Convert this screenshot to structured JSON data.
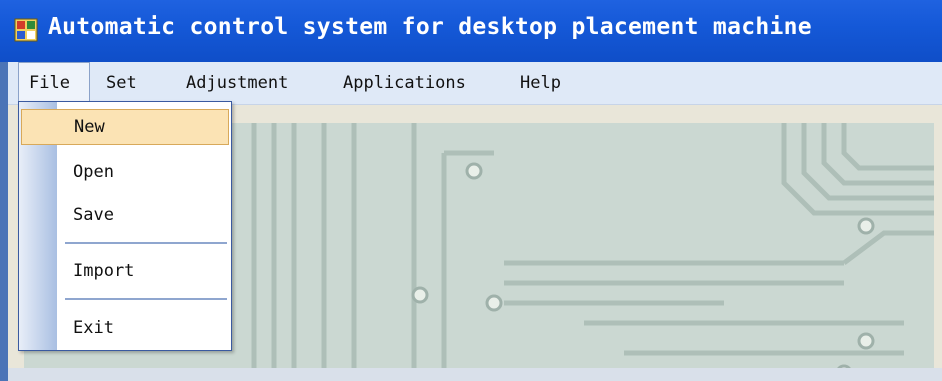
{
  "window": {
    "title": "Automatic control system for desktop placement machine",
    "icon": "app-window-icon"
  },
  "menubar": {
    "items": [
      {
        "label": "File",
        "active": true
      },
      {
        "label": "Set"
      },
      {
        "label": "Adjustment"
      },
      {
        "label": "Applications"
      },
      {
        "label": "Help"
      }
    ]
  },
  "file_menu": {
    "items": [
      {
        "label": "New",
        "highlighted": true
      },
      {
        "label": "Open"
      },
      {
        "label": "Save"
      },
      {
        "label": "Import"
      },
      {
        "label": "Exit"
      }
    ]
  },
  "colors": {
    "titlebar": "#1559d8",
    "menubar": "#dfe9f7",
    "highlight": "#fbe3b4",
    "pcb_board": "#c9d6cf"
  }
}
